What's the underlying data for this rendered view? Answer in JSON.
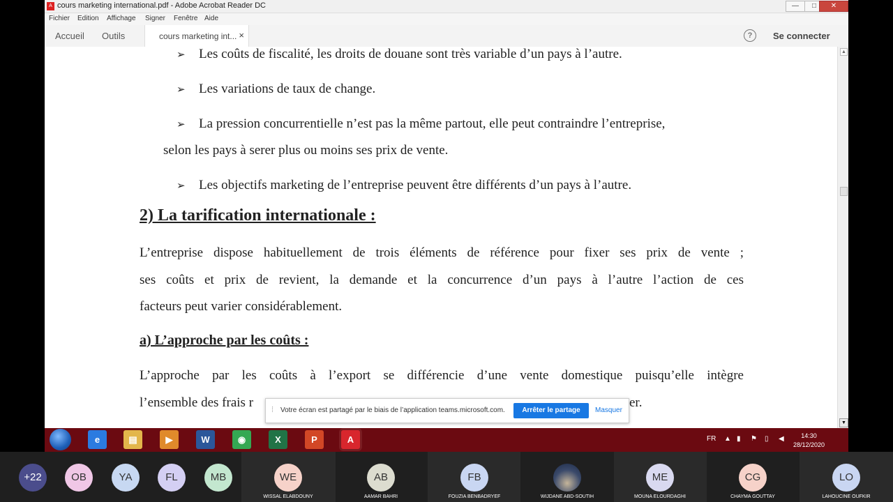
{
  "window": {
    "title": "cours marketing international.pdf - Adobe Acrobat Reader DC",
    "file_icon": "pdf-icon",
    "minimize_glyph": "—",
    "maximize_glyph": "□",
    "close_glyph": "✕"
  },
  "menu": {
    "items": [
      "Fichier",
      "Edition",
      "Affichage",
      "Signer",
      "Fenêtre",
      "Aide"
    ]
  },
  "tabs": {
    "home": "Accueil",
    "tools": "Outils",
    "document": "cours marketing int...",
    "close_glyph": "×",
    "help_glyph": "?",
    "signin": "Se connecter"
  },
  "document": {
    "bullets": [
      "Les coûts de fiscalité, les droits de douane sont très variable d’un pays à l’autre.",
      "Les variations de taux de change.",
      "La pression concurrentielle n’est pas la même partout, elle peut contraindre l’entreprise,",
      "Les objectifs marketing de l’entreprise peuvent être différents d’un pays à l’autre."
    ],
    "bullet3_continuation": "selon les pays à serer plus ou moins ses prix de vente.",
    "heading": "2) La tarification internationale :",
    "paragraph1": [
      "L’entreprise dispose habituellement de trois éléments de référence pour fixer ses prix de vente ;",
      "ses coûts et prix de revient, la demande et la concurrence d’un pays à l’autre l’action de ces",
      "facteurs peut varier considérablement."
    ],
    "subheading": "a) L’approche par les coûts :",
    "paragraph2": [
      "L’approche par les coûts à l’export se différencie d’une vente domestique puisqu’elle intègre",
      "l’ensemble des frais r",
      "er."
    ]
  },
  "share_banner": {
    "message": "Votre écran est partagé par le biais de l’application teams.microsoft.com.",
    "stop_label": "Arrêter le partage",
    "hide_label": "Masquer"
  },
  "taskbar": {
    "apps": [
      {
        "name": "internet-explorer",
        "glyph": "e",
        "color": "#2b7be0"
      },
      {
        "name": "file-explorer",
        "glyph": "▤",
        "color": "#e3b64b"
      },
      {
        "name": "media-player",
        "glyph": "▶",
        "color": "#e08a2b"
      },
      {
        "name": "word",
        "glyph": "W",
        "color": "#2b579a"
      },
      {
        "name": "chrome",
        "glyph": "◉",
        "color": "#34a853"
      },
      {
        "name": "excel",
        "glyph": "X",
        "color": "#217346"
      },
      {
        "name": "powerpoint",
        "glyph": "P",
        "color": "#d24726"
      },
      {
        "name": "acrobat",
        "glyph": "A",
        "color": "#d8262d"
      }
    ],
    "language": "FR",
    "time": "14:30",
    "date": "28/12/2020"
  },
  "participants": [
    {
      "initials": "+22",
      "name": "",
      "color": "#4b4d8c"
    },
    {
      "initials": "OB",
      "name": "",
      "color": "#f0c7e6"
    },
    {
      "initials": "YA",
      "name": "",
      "color": "#c7d8f2"
    },
    {
      "initials": "FL",
      "name": "",
      "color": "#d4cff3"
    },
    {
      "initials": "MB",
      "name": "",
      "color": "#c3e7cf"
    },
    {
      "initials": "WE",
      "name": "WISSAL ELABDOUNY",
      "color": "#f6d2c9"
    },
    {
      "initials": "AB",
      "name": "AAMAR BAHRI",
      "color": "#dcdccf"
    },
    {
      "initials": "FB",
      "name": "FOUZIA BENBADRYEF",
      "color": "#c9d6f2"
    },
    {
      "initials": "",
      "name": "WIJDANE ABD-SOUTIH",
      "color": "#6e7aa0"
    },
    {
      "initials": "ME",
      "name": "MOUNA ELOURDAGHI",
      "color": "#d9d9f0"
    },
    {
      "initials": "CG",
      "name": "CHAYMA GOUTTAY",
      "color": "#f6d2c9"
    },
    {
      "initials": "LO",
      "name": "LAHOUCINE OUFKIR",
      "color": "#c9d6f2"
    }
  ]
}
